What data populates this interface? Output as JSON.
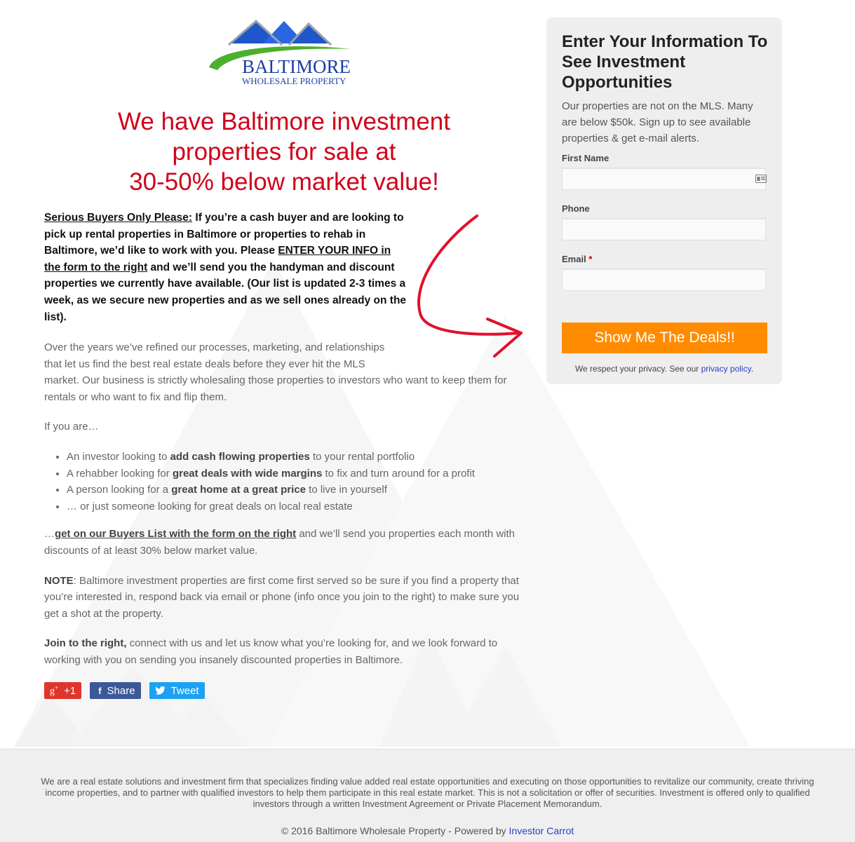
{
  "logo": {
    "line1": "BALTIMORE",
    "line2": "WHOLESALE PROPERTY",
    "colors": {
      "roof": "#1f56c9",
      "swoosh": "#4caf2d",
      "text": "#1a3ea6"
    }
  },
  "headline": {
    "line1": "We have Baltimore investment",
    "line2": "properties for sale at",
    "line3": "30-50% below market value!",
    "color": "#d0021b"
  },
  "intro": {
    "lead": "Serious Buyers Only Please:",
    "text1": " If you’re a cash buyer and are looking to pick up rental properties in Baltimore or properties to rehab in Baltimore, we’d like to work with you. Please ",
    "link": "ENTER YOUR INFO in the form to the right",
    "text2": " and we’ll send you the handyman and discount properties we currently have available. (Our list is updated 2-3 times a week, as we secure new properties and as we sell ones already on the list)."
  },
  "body": {
    "p1a": "Over the years we’ve refined our processes, marketing, and relationships that let us find the best real estate deals before they ever hit the MLS",
    "p1b": "market.  Our business is strictly wholesaling those properties to investors who want to keep them for rentals or who want to fix and flip them.",
    "if_you_are": "If you are…",
    "bullets": [
      {
        "pre": "An investor looking to ",
        "bold": "add cash flowing properties",
        "post": " to your rental portfolio"
      },
      {
        "pre": "A rehabber looking for ",
        "bold": "great deals with wide margins",
        "post": " to fix and turn around for a profit"
      },
      {
        "pre": "A person looking for a ",
        "bold": "great home at a great price",
        "post": " to live in yourself"
      },
      {
        "pre": "… or just someone looking for great deals on local real estate",
        "bold": "",
        "post": ""
      }
    ],
    "buyers_pre": "…",
    "buyers_link": "get on our Buyers List with the form on the right",
    "buyers_post": " and we’ll send you properties each month with discounts of at least 30% below market value.",
    "note_label": "NOTE",
    "note_text": ": Baltimore investment properties are first come first served so be sure if you find a property that you’re interested in, respond back via email or phone (info once you join to the right) to make sure you get a shot at the property.",
    "join_label": "Join to the right,",
    "join_text": " connect with us and let us know what you’re looking for, and we look forward to working with you on sending you insanely discounted properties in Baltimore."
  },
  "social": {
    "gplus_label": "+1",
    "facebook_label": "Share",
    "twitter_label": "Tweet"
  },
  "form": {
    "title": "Enter Your Information To See Investment Opportunities",
    "subtitle": "Our properties are not on the MLS. Many are below $50k. Sign up to see available properties & get e-mail alerts.",
    "first_name_label": "First Name",
    "first_name_value": "",
    "phone_label": "Phone",
    "phone_value": "",
    "email_label": "Email",
    "email_required": "*",
    "email_value": "",
    "submit_label": "Show Me The Deals!!",
    "privacy_text": "We respect your privacy. See our ",
    "privacy_link": "privacy policy",
    "privacy_end": ".",
    "submit_color": "#ff8c00"
  },
  "footer": {
    "disclaimer": "We are a real estate solutions and investment firm that specializes finding value added real estate opportunities and executing on those opportunities to revitalize our community, create thriving income properties, and to partner with qualified investors to help them participate in this real estate market. This is not a solicitation or offer of securities. Investment is offered only to qualified investors through a written Investment Agreement or Private Placement Memorandum.",
    "copyright": "© 2016 Baltimore Wholesale Property - Powered by ",
    "powered_link": "Investor Carrot"
  }
}
